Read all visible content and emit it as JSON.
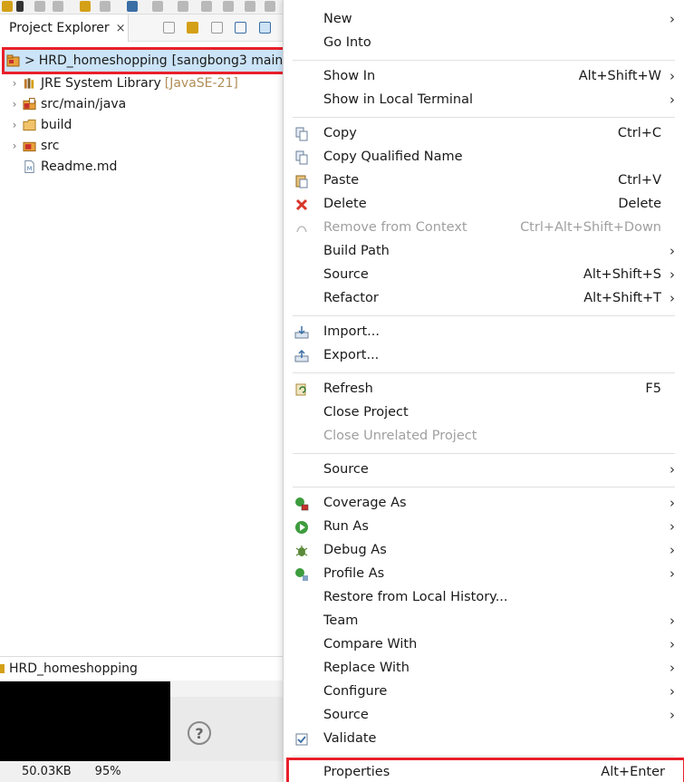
{
  "explorer": {
    "tab_title": "Project Explorer",
    "tab_close": "×",
    "root": {
      "prefix": ">",
      "label": "HRD_homeshopping",
      "decoration": "[sangbong3 main"
    },
    "items": [
      {
        "label": "JRE System Library",
        "decoration": "[JavaSE-21]",
        "has_twisty": true,
        "icon": "library-icon"
      },
      {
        "label": "src/main/java",
        "decoration": "",
        "has_twisty": true,
        "icon": "source-folder-icon"
      },
      {
        "label": "build",
        "decoration": "",
        "has_twisty": true,
        "icon": "folder-icon"
      },
      {
        "label": "src",
        "decoration": "",
        "has_twisty": true,
        "icon": "src-folder-icon"
      },
      {
        "label": "Readme.md",
        "decoration": "",
        "has_twisty": false,
        "icon": "file-icon"
      }
    ]
  },
  "bottom_view": {
    "title": "HRD_homeshopping",
    "help": "?"
  },
  "status": {
    "size": "50.03KB",
    "zoom": "95%"
  },
  "context_menu": {
    "items": [
      {
        "label": "New",
        "accel": "",
        "submenu": true,
        "disabled": false,
        "icon": ""
      },
      {
        "label": "Go Into",
        "accel": "",
        "submenu": false,
        "disabled": false,
        "icon": ""
      },
      {
        "sep": true
      },
      {
        "label": "Show In",
        "accel": "Alt+Shift+W",
        "submenu": true,
        "disabled": false,
        "icon": ""
      },
      {
        "label": "Show in Local Terminal",
        "accel": "",
        "submenu": true,
        "disabled": false,
        "icon": ""
      },
      {
        "sep": true
      },
      {
        "label": "Copy",
        "accel": "Ctrl+C",
        "submenu": false,
        "disabled": false,
        "icon": "copy-icon"
      },
      {
        "label": "Copy Qualified Name",
        "accel": "",
        "submenu": false,
        "disabled": false,
        "icon": "copy-qualified-icon"
      },
      {
        "label": "Paste",
        "accel": "Ctrl+V",
        "submenu": false,
        "disabled": false,
        "icon": "paste-icon"
      },
      {
        "label": "Delete",
        "accel": "Delete",
        "submenu": false,
        "disabled": false,
        "icon": "delete-icon"
      },
      {
        "label": "Remove from Context",
        "accel": "Ctrl+Alt+Shift+Down",
        "submenu": false,
        "disabled": true,
        "icon": "remove-context-icon"
      },
      {
        "label": "Build Path",
        "accel": "",
        "submenu": true,
        "disabled": false,
        "icon": ""
      },
      {
        "label": "Source",
        "accel": "Alt+Shift+S",
        "submenu": true,
        "disabled": false,
        "icon": ""
      },
      {
        "label": "Refactor",
        "accel": "Alt+Shift+T",
        "submenu": true,
        "disabled": false,
        "icon": ""
      },
      {
        "sep": true
      },
      {
        "label": "Import...",
        "accel": "",
        "submenu": false,
        "disabled": false,
        "icon": "import-icon"
      },
      {
        "label": "Export...",
        "accel": "",
        "submenu": false,
        "disabled": false,
        "icon": "export-icon"
      },
      {
        "sep": true
      },
      {
        "label": "Refresh",
        "accel": "F5",
        "submenu": false,
        "disabled": false,
        "icon": "refresh-icon"
      },
      {
        "label": "Close Project",
        "accel": "",
        "submenu": false,
        "disabled": false,
        "icon": ""
      },
      {
        "label": "Close Unrelated Project",
        "accel": "",
        "submenu": false,
        "disabled": true,
        "icon": ""
      },
      {
        "sep": true
      },
      {
        "label": "Source",
        "accel": "",
        "submenu": true,
        "disabled": false,
        "icon": ""
      },
      {
        "sep": true
      },
      {
        "label": "Coverage As",
        "accel": "",
        "submenu": true,
        "disabled": false,
        "icon": "coverage-icon"
      },
      {
        "label": "Run As",
        "accel": "",
        "submenu": true,
        "disabled": false,
        "icon": "run-icon"
      },
      {
        "label": "Debug As",
        "accel": "",
        "submenu": true,
        "disabled": false,
        "icon": "debug-icon"
      },
      {
        "label": "Profile As",
        "accel": "",
        "submenu": true,
        "disabled": false,
        "icon": "profile-icon"
      },
      {
        "label": "Restore from Local History...",
        "accel": "",
        "submenu": false,
        "disabled": false,
        "icon": ""
      },
      {
        "label": "Team",
        "accel": "",
        "submenu": true,
        "disabled": false,
        "icon": ""
      },
      {
        "label": "Compare With",
        "accel": "",
        "submenu": true,
        "disabled": false,
        "icon": ""
      },
      {
        "label": "Replace With",
        "accel": "",
        "submenu": true,
        "disabled": false,
        "icon": ""
      },
      {
        "label": "Configure",
        "accel": "",
        "submenu": true,
        "disabled": false,
        "icon": ""
      },
      {
        "label": "Source",
        "accel": "",
        "submenu": true,
        "disabled": false,
        "icon": ""
      },
      {
        "label": "Validate",
        "accel": "",
        "submenu": false,
        "disabled": false,
        "icon": "validate-check-icon"
      },
      {
        "sep": true
      },
      {
        "label": "Properties",
        "accel": "Alt+Enter",
        "submenu": false,
        "disabled": false,
        "icon": "",
        "highlight": true
      }
    ]
  },
  "colors": {
    "selection": "#cce4f7",
    "highlight_box": "#e8202a",
    "disabled_text": "#a0a0a0"
  }
}
